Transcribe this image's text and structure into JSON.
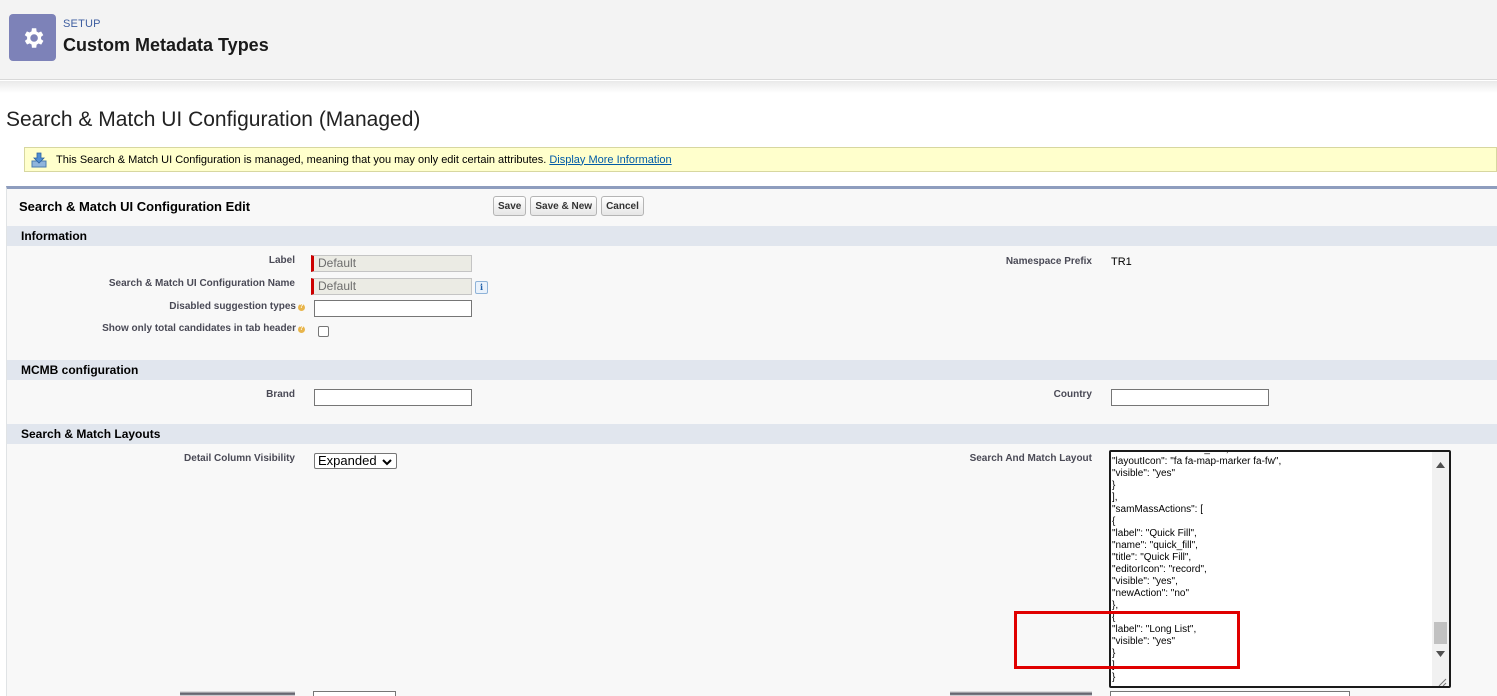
{
  "header": {
    "eyebrow": "SETUP",
    "title": "Custom Metadata Types",
    "icon": "gear-icon",
    "icon_bg": "#7d82b8"
  },
  "page": {
    "title": "Search & Match UI Configuration (Managed)"
  },
  "managed_message": {
    "text": "This Search & Match UI Configuration is managed, meaning that you may only edit certain attributes.",
    "link": "Display More Information",
    "icon": "download-icon"
  },
  "edit": {
    "title": "Search & Match UI Configuration Edit",
    "buttons": {
      "save": "Save",
      "save_new": "Save & New",
      "cancel": "Cancel"
    }
  },
  "sections": {
    "information": {
      "title": "Information",
      "label_label": "Label",
      "label_value": "Default",
      "config_name_label": "Search & Match UI Configuration Name",
      "config_name_value": "Default",
      "disabled_types_label": "Disabled suggestion types",
      "disabled_types_value": "",
      "show_total_label": "Show only total candidates in tab header",
      "show_total_checked": false,
      "namespace_label": "Namespace Prefix",
      "namespace_value": "TR1"
    },
    "mcmb": {
      "title": "MCMB configuration",
      "brand_label": "Brand",
      "brand_value": "",
      "country_label": "Country",
      "country_value": ""
    },
    "layouts": {
      "title": "Search & Match Layouts",
      "detail_visibility_label": "Detail Column Visibility",
      "detail_visibility_value": "Expanded",
      "search_layout_label": "Search And Match Layout",
      "search_layout_lines": [
        "\"editorIcon\": \"contact_list\",",
        "\"layoutIcon\": \"fa fa-map-marker fa-fw\",",
        "\"visible\": \"yes\"",
        "}",
        "],",
        "\"samMassActions\": [",
        "{",
        "\"label\": \"Quick Fill\",",
        "\"name\": \"quick_fill\",",
        "\"title\": \"Quick Fill\",",
        "\"editorIcon\": \"record\",",
        "\"visible\": \"yes\",",
        "\"newAction\": \"no\"",
        "},",
        "{",
        "\"label\": \"Long List\",",
        "\"visible\": \"yes\"",
        "}",
        "]",
        "}"
      ]
    }
  },
  "colors": {
    "section_header": "#e1e6ee",
    "block_border": "#8e9dbe",
    "required_marker": "#cc0000",
    "highlight_box": "#e00000",
    "message_bg": "#ffffcc"
  }
}
